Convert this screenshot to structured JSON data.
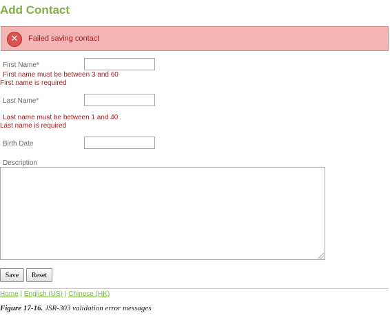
{
  "page": {
    "title": "Add Contact"
  },
  "error_banner": {
    "icon": "error-x-icon",
    "message": "Failed saving contact"
  },
  "form": {
    "first_name": {
      "label": "First Name*",
      "value": "",
      "errors": [
        "First name must be between 3 and 60",
        "First name is required"
      ]
    },
    "last_name": {
      "label": "Last Name*",
      "value": "",
      "errors": [
        "Last name must be between 1 and 40",
        "Last name is required"
      ]
    },
    "birth_date": {
      "label": "Birth Date",
      "value": ""
    },
    "description": {
      "label": "Description",
      "value": ""
    },
    "save_label": "Save",
    "reset_label": "Reset"
  },
  "footer": {
    "links": [
      "Home",
      "English (US)",
      "Chinese (HK)"
    ],
    "separator": "|"
  },
  "caption": {
    "figure": "Figure 17-16.",
    "text": "JSR-303 validation error messages"
  },
  "colors": {
    "title_green": "#7cb342",
    "error_bg": "#f3b5b5",
    "error_text": "#a11d1d"
  }
}
